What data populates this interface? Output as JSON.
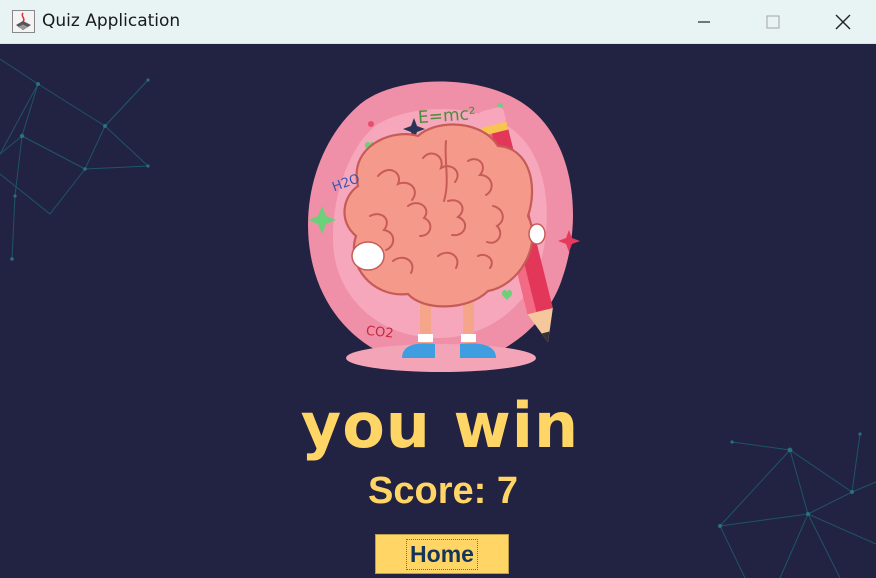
{
  "window": {
    "title": "Quiz Application",
    "app_icon": "java-app-icon",
    "controls": [
      "minimize-icon",
      "maximize-icon",
      "close-icon"
    ]
  },
  "main": {
    "illustration": "cartoon-brain-with-pencil",
    "illustration_text": [
      "E=mc²",
      "H2O",
      "CO2"
    ],
    "result_message": "you win",
    "score_text": "Score: 7",
    "home_button_label": "Home"
  },
  "colors": {
    "background": "#222342",
    "titlebar": "#e8f4f4",
    "accent_yellow": "#ffd566",
    "button_text": "#143558",
    "network_lines": "#1d6573"
  }
}
